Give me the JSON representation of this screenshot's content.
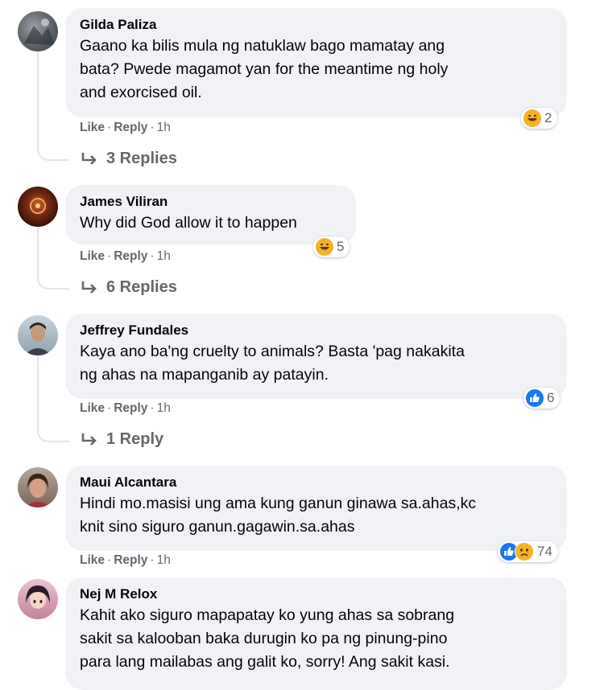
{
  "actions": {
    "like": "Like",
    "reply": "Reply",
    "separator": "·"
  },
  "comments": [
    {
      "author": "Gilda Paliza",
      "lines": [
        "Gaano ka bilis mula ng natuklaw bago mamatay ang",
        "bata? Pwede magamot yan for the meantime ng holy",
        "and exorcised oil."
      ],
      "time": "1h",
      "reactions": {
        "icons": [
          "haha-icon"
        ],
        "count": "2"
      },
      "replies": "3 Replies"
    },
    {
      "author": "James Viliran",
      "lines": [
        "Why did God allow it to happen"
      ],
      "time": "1h",
      "reactions": {
        "icons": [
          "haha-icon"
        ],
        "count": "5"
      },
      "replies": "6 Replies"
    },
    {
      "author": "Jeffrey Fundales",
      "lines": [
        "Kaya ano ba'ng cruelty to animals? Basta 'pag nakakita",
        "ng ahas na mapanganib ay patayin."
      ],
      "time": "1h",
      "reactions": {
        "icons": [
          "like-icon"
        ],
        "count": "6"
      },
      "replies": "1 Reply"
    },
    {
      "author": "Maui Alcantara",
      "lines": [
        "Hindi mo.masisi ung ama kung ganun ginawa sa.ahas,kc",
        "knit sino siguro ganun.gagawin.sa.ahas"
      ],
      "time": "1h",
      "reactions": {
        "icons": [
          "like-icon",
          "sad-icon"
        ],
        "count": "74"
      }
    },
    {
      "author": "Nej M Relox",
      "lines": [
        "Kahit ako siguro mapapatay ko yung ahas sa sobrang",
        "sakit sa kalooban baka durugin ko pa ng pinung-pino",
        "para lang mailabas ang galit ko, sorry! Ang sakit kasi."
      ]
    }
  ],
  "colors": {
    "bubble": "#f0f2f5",
    "meta": "#65676b",
    "like_blue": "#1877f2",
    "haha_yellow": "#f7b125"
  }
}
